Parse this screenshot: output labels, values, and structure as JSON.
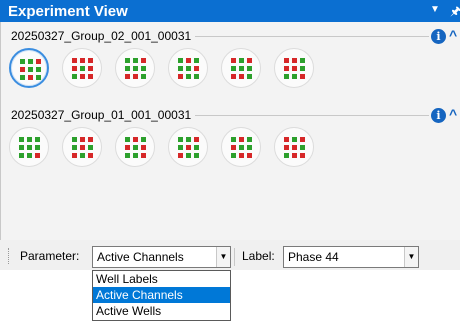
{
  "window": {
    "title": "Experiment View",
    "menu_glyph": "▼",
    "pin_glyph": "🖈"
  },
  "groups": [
    {
      "name": "20250327_Group_02_001_00031",
      "selected_well": 0,
      "wells": [
        {
          "pattern": [
            [
              "g",
              "g",
              "r"
            ],
            [
              "r",
              "g",
              "g"
            ],
            [
              "g",
              "r",
              "g"
            ]
          ]
        },
        {
          "pattern": [
            [
              "r",
              "r",
              "r"
            ],
            [
              "r",
              "g",
              "r"
            ],
            [
              "g",
              "r",
              "r"
            ]
          ]
        },
        {
          "pattern": [
            [
              "g",
              "g",
              "r"
            ],
            [
              "g",
              "g",
              "g"
            ],
            [
              "r",
              "r",
              "g"
            ]
          ]
        },
        {
          "pattern": [
            [
              "g",
              "r",
              "g"
            ],
            [
              "g",
              "g",
              "r"
            ],
            [
              "r",
              "g",
              "g"
            ]
          ]
        },
        {
          "pattern": [
            [
              "r",
              "g",
              "r"
            ],
            [
              "g",
              "g",
              "g"
            ],
            [
              "r",
              "r",
              "g"
            ]
          ]
        },
        {
          "pattern": [
            [
              "r",
              "r",
              "g"
            ],
            [
              "r",
              "r",
              "g"
            ],
            [
              "g",
              "g",
              "r"
            ]
          ]
        }
      ]
    },
    {
      "name": "20250327_Group_01_001_00031",
      "selected_well": null,
      "wells": [
        {
          "pattern": [
            [
              "g",
              "g",
              "g"
            ],
            [
              "g",
              "g",
              "g"
            ],
            [
              "g",
              "g",
              "r"
            ]
          ]
        },
        {
          "pattern": [
            [
              "g",
              "r",
              "r"
            ],
            [
              "g",
              "r",
              "g"
            ],
            [
              "r",
              "g",
              "r"
            ]
          ]
        },
        {
          "pattern": [
            [
              "g",
              "r",
              "g"
            ],
            [
              "r",
              "g",
              "r"
            ],
            [
              "g",
              "g",
              "r"
            ]
          ]
        },
        {
          "pattern": [
            [
              "g",
              "g",
              "r"
            ],
            [
              "g",
              "r",
              "g"
            ],
            [
              "r",
              "g",
              "g"
            ]
          ]
        },
        {
          "pattern": [
            [
              "g",
              "r",
              "g"
            ],
            [
              "r",
              "g",
              "g"
            ],
            [
              "g",
              "r",
              "r"
            ]
          ]
        },
        {
          "pattern": [
            [
              "r",
              "g",
              "r"
            ],
            [
              "r",
              "r",
              "g"
            ],
            [
              "g",
              "r",
              "r"
            ]
          ]
        }
      ]
    }
  ],
  "icons": {
    "info": "i",
    "collapse": "^"
  },
  "colors": {
    "green": "#2ca02c",
    "red": "#d62728",
    "title_bar": "#0b6fd1",
    "selection": "#0078d7"
  },
  "toolbar": {
    "parameter_label": "Parameter:",
    "parameter_value": "Active Channels",
    "label_label": "Label:",
    "label_value": "Phase 44",
    "combo_arrow": "▼"
  },
  "parameter_options": [
    "Well Labels",
    "Active Channels",
    "Active Wells"
  ],
  "parameter_selected_index": 1
}
